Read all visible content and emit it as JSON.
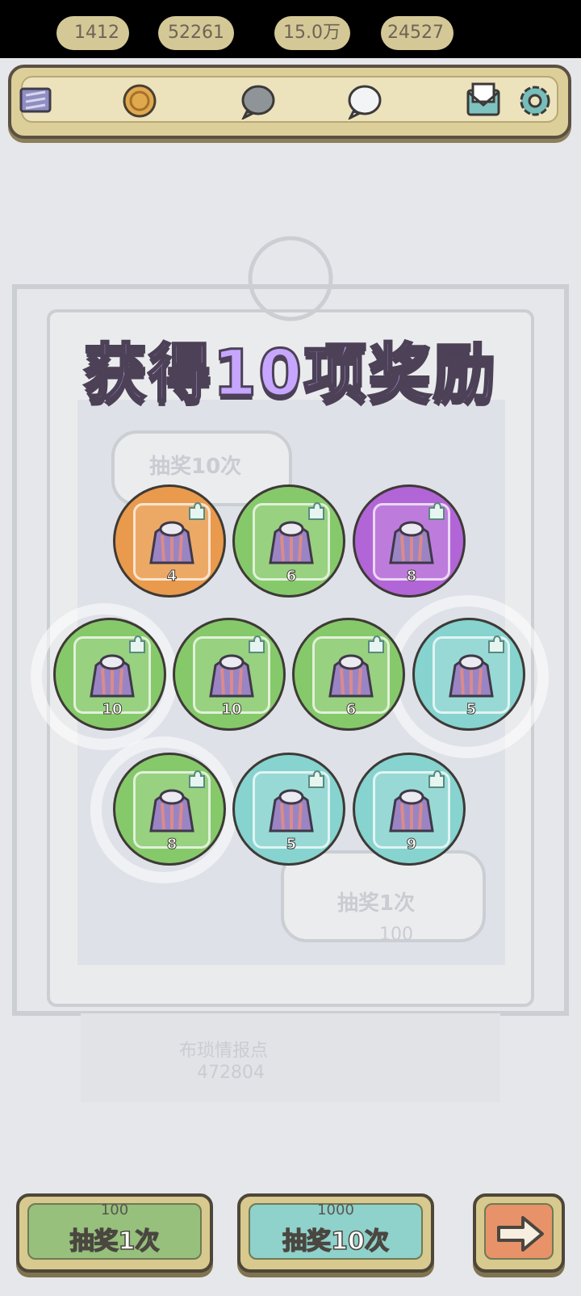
{
  "header": {
    "tickets": "1412",
    "coins": "52261",
    "dark_gems": "15.0万",
    "light_gems": "24527"
  },
  "background": {
    "draw10_label": "抽奖10次",
    "draw1_label": "抽奖1次",
    "draw1_cost": "100",
    "info_label": "布琐情报点",
    "info_value": "472804"
  },
  "title": "获得10项奖励",
  "rewards": [
    {
      "count": "4",
      "color": "#e99a4c"
    },
    {
      "count": "6",
      "color": "#86c96a"
    },
    {
      "count": "8",
      "color": "#b265d6"
    },
    {
      "count": "10",
      "color": "#86c96a"
    },
    {
      "count": "10",
      "color": "#86c96a"
    },
    {
      "count": "6",
      "color": "#86c96a"
    },
    {
      "count": "5",
      "color": "#86d3cf"
    },
    {
      "count": "8",
      "color": "#86c96a"
    },
    {
      "count": "5",
      "color": "#86d3cf"
    },
    {
      "count": "9",
      "color": "#86d3cf"
    }
  ],
  "buttons": {
    "draw1": {
      "cost": "100",
      "label": "抽奖1次"
    },
    "draw10": {
      "cost": "1000",
      "label": "抽奖10次"
    }
  }
}
